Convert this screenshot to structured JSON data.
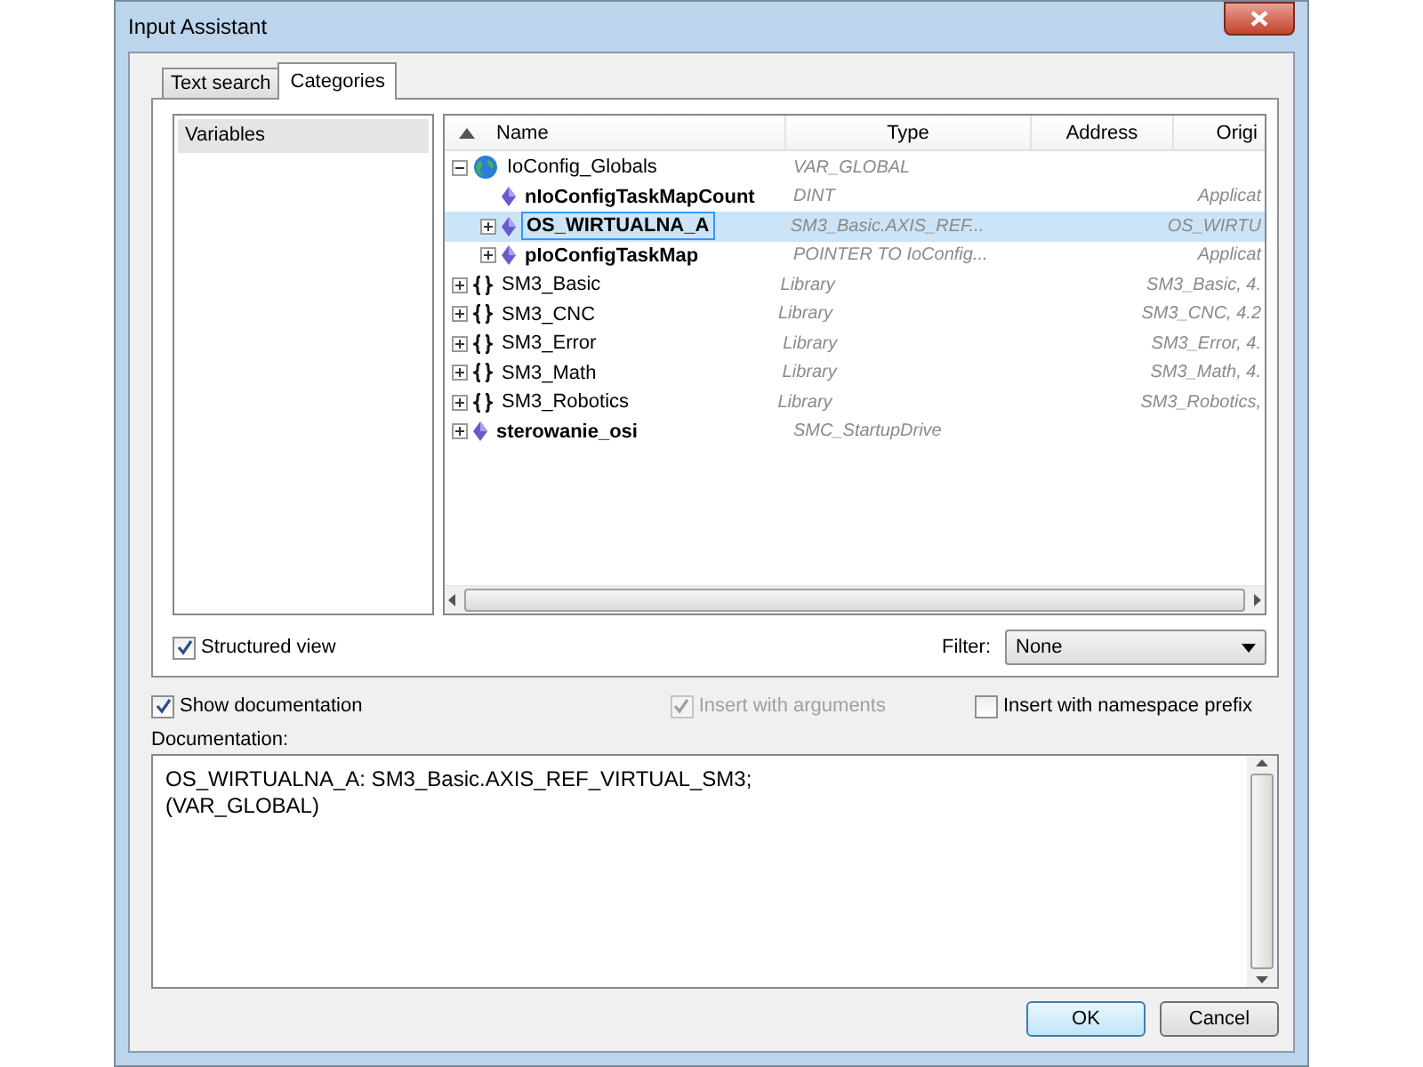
{
  "window": {
    "title": "Input Assistant"
  },
  "tabs": [
    {
      "label": "Text search",
      "selected": false
    },
    {
      "label": "Categories",
      "selected": true
    }
  ],
  "categories": [
    {
      "label": "Variables",
      "selected": true
    }
  ],
  "tree": {
    "columns": [
      "Name",
      "Type",
      "Address",
      "Origi"
    ],
    "rows": [
      {
        "kind": "globals",
        "name": "IoConfig_Globals",
        "type": "VAR_GLOBAL",
        "origin": "",
        "expanded": true,
        "selected": false,
        "children": [
          {
            "kind": "variable",
            "name": "nIoConfigTaskMapCount",
            "type": "DINT",
            "origin": "Applicat",
            "selected": false
          },
          {
            "kind": "variable",
            "name": "OS_WIRTUALNA_A",
            "type": "SM3_Basic.AXIS_REF...",
            "origin": "OS_WIRTU",
            "expanded": false,
            "selected": true
          },
          {
            "kind": "variable",
            "name": "pIoConfigTaskMap",
            "type": "POINTER TO IoConfig...",
            "origin": "Applicat",
            "expanded": false,
            "selected": false
          }
        ]
      },
      {
        "kind": "library",
        "name": "SM3_Basic",
        "type": "Library",
        "origin": "SM3_Basic, 4.",
        "expanded": false,
        "selected": false
      },
      {
        "kind": "library",
        "name": "SM3_CNC",
        "type": "Library",
        "origin": "SM3_CNC, 4.2",
        "expanded": false,
        "selected": false
      },
      {
        "kind": "library",
        "name": "SM3_Error",
        "type": "Library",
        "origin": "SM3_Error, 4.",
        "expanded": false,
        "selected": false
      },
      {
        "kind": "library",
        "name": "SM3_Math",
        "type": "Library",
        "origin": "SM3_Math, 4.",
        "expanded": false,
        "selected": false
      },
      {
        "kind": "library",
        "name": "SM3_Robotics",
        "type": "Library",
        "origin": "SM3_Robotics,",
        "expanded": false,
        "selected": false
      },
      {
        "kind": "variable",
        "name": "sterowanie_osi",
        "type": "SMC_StartupDrive",
        "origin": "",
        "expanded": false,
        "selected": false
      }
    ]
  },
  "structured_view": {
    "label": "Structured view",
    "checked": true
  },
  "filter": {
    "label": "Filter:",
    "value": "None"
  },
  "options": [
    {
      "label": "Show documentation",
      "checked": true,
      "disabled": false
    },
    {
      "label": "Insert with arguments",
      "checked": true,
      "disabled": true
    },
    {
      "label": "Insert with namespace prefix",
      "checked": false,
      "disabled": false
    }
  ],
  "documentation": {
    "label": "Documentation:",
    "lines": [
      "OS_WIRTUALNA_A: SM3_Basic.AXIS_REF_VIRTUAL_SM3;",
      "(VAR_GLOBAL)"
    ]
  },
  "buttons": [
    {
      "label": "OK",
      "default": true
    },
    {
      "label": "Cancel",
      "default": false
    }
  ]
}
